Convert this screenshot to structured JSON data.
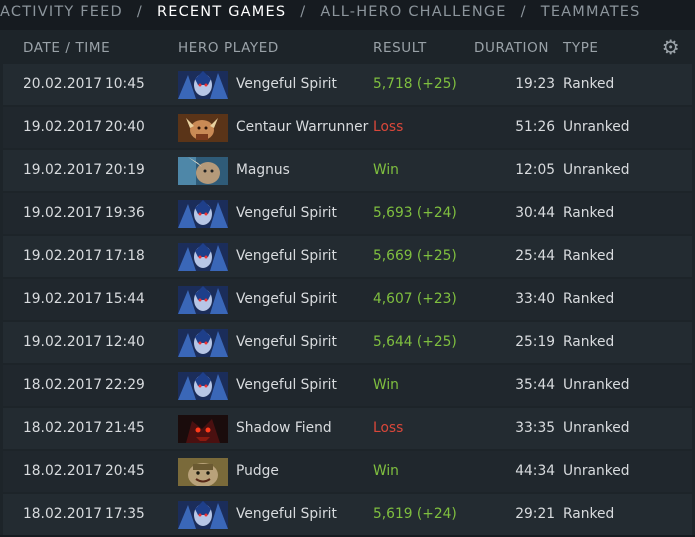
{
  "nav": {
    "tabs": [
      "ACTIVITY FEED",
      "RECENT GAMES",
      "ALL-HERO CHALLENGE",
      "TEAMMATES"
    ],
    "separator": "/"
  },
  "header": {
    "date_time": "DATE / TIME",
    "hero_played": "HERO PLAYED",
    "result": "RESULT",
    "duration": "DURATION",
    "type": "TYPE",
    "settings_icon": "gear-icon"
  },
  "colors": {
    "win": "#7fbf3f",
    "loss": "#d9473a"
  },
  "games": [
    {
      "date": "20.02.2017",
      "time": "10:45",
      "hero": "Vengeful Spirit",
      "hero_icon": "vengeful-spirit",
      "result": "5,718 (+25)",
      "result_kind": "mmr",
      "duration": "19:23",
      "type": "Ranked"
    },
    {
      "date": "19.02.2017",
      "time": "20:40",
      "hero": "Centaur Warrunner",
      "hero_icon": "centaur-warrunner",
      "result": "Loss",
      "result_kind": "loss",
      "duration": "51:26",
      "type": "Unranked"
    },
    {
      "date": "19.02.2017",
      "time": "20:19",
      "hero": "Magnus",
      "hero_icon": "magnus",
      "result": "Win",
      "result_kind": "win",
      "duration": "12:05",
      "type": "Unranked"
    },
    {
      "date": "19.02.2017",
      "time": "19:36",
      "hero": "Vengeful Spirit",
      "hero_icon": "vengeful-spirit",
      "result": "5,693 (+24)",
      "result_kind": "mmr",
      "duration": "30:44",
      "type": "Ranked"
    },
    {
      "date": "19.02.2017",
      "time": "17:18",
      "hero": "Vengeful Spirit",
      "hero_icon": "vengeful-spirit",
      "result": "5,669 (+25)",
      "result_kind": "mmr",
      "duration": "25:44",
      "type": "Ranked"
    },
    {
      "date": "19.02.2017",
      "time": "15:44",
      "hero": "Vengeful Spirit",
      "hero_icon": "vengeful-spirit",
      "result": "4,607 (+23)",
      "result_kind": "mmr",
      "duration": "33:40",
      "type": "Ranked"
    },
    {
      "date": "19.02.2017",
      "time": "12:40",
      "hero": "Vengeful Spirit",
      "hero_icon": "vengeful-spirit",
      "result": "5,644 (+25)",
      "result_kind": "mmr",
      "duration": "25:19",
      "type": "Ranked"
    },
    {
      "date": "18.02.2017",
      "time": "22:29",
      "hero": "Vengeful Spirit",
      "hero_icon": "vengeful-spirit",
      "result": "Win",
      "result_kind": "win",
      "duration": "35:44",
      "type": "Unranked"
    },
    {
      "date": "18.02.2017",
      "time": "21:45",
      "hero": "Shadow Fiend",
      "hero_icon": "shadow-fiend",
      "result": "Loss",
      "result_kind": "loss",
      "duration": "33:35",
      "type": "Unranked"
    },
    {
      "date": "18.02.2017",
      "time": "20:45",
      "hero": "Pudge",
      "hero_icon": "pudge",
      "result": "Win",
      "result_kind": "win",
      "duration": "44:34",
      "type": "Unranked"
    },
    {
      "date": "18.02.2017",
      "time": "17:35",
      "hero": "Vengeful Spirit",
      "hero_icon": "vengeful-spirit",
      "result": "5,619 (+24)",
      "result_kind": "mmr",
      "duration": "29:21",
      "type": "Ranked"
    }
  ]
}
